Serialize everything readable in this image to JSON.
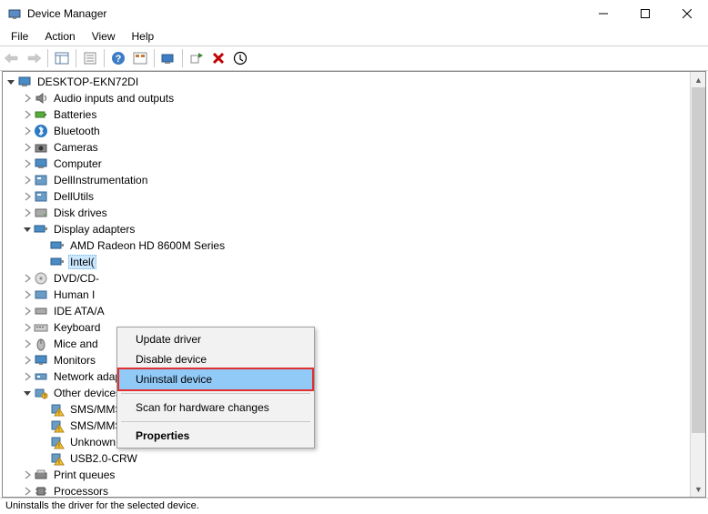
{
  "titlebar": {
    "title": "Device Manager"
  },
  "menubar": {
    "file": "File",
    "action": "Action",
    "view": "View",
    "help": "Help"
  },
  "tree": {
    "root": "DESKTOP-EKN72DI",
    "nodes": {
      "audio": "Audio inputs and outputs",
      "batteries": "Batteries",
      "bluetooth": "Bluetooth",
      "cameras": "Cameras",
      "computer": "Computer",
      "dellinstr": "DellInstrumentation",
      "dellutils": "DellUtils",
      "disk": "Disk drives",
      "display": "Display adapters",
      "amd": "AMD Radeon HD 8600M Series",
      "intel": "Intel(",
      "dvd": "DVD/CD-",
      "human": "Human I",
      "ide": "IDE ATA/A",
      "keyboard": "Keyboard",
      "mice": "Mice and",
      "monitors": "Monitors",
      "network": "Network adapters",
      "other": "Other devices",
      "sms1": "SMS/MMS",
      "sms2": "SMS/MMS",
      "unknown": "Unknown device",
      "usb2crw": "USB2.0-CRW",
      "printq": "Print queues",
      "processors": "Processors"
    }
  },
  "context_menu": {
    "update": "Update driver",
    "disable": "Disable device",
    "uninstall": "Uninstall device",
    "scan": "Scan for hardware changes",
    "props": "Properties"
  },
  "statusbar": {
    "text": "Uninstalls the driver for the selected device."
  }
}
